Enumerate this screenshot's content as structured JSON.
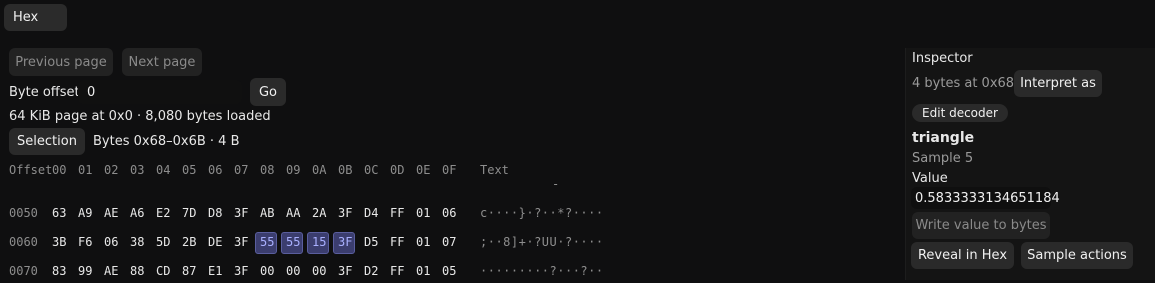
{
  "view_select": {
    "value": "Hex"
  },
  "nav": {
    "previous_page": "Previous page",
    "next_page": "Next page"
  },
  "offset": {
    "label": "Byte offset",
    "value": "0",
    "go": "Go"
  },
  "page_info": "64 KiB page at 0x0 · 8,080 bytes loaded",
  "selection": {
    "button": "Selection",
    "range": "Bytes 0x68–0x6B · 4 B"
  },
  "hex": {
    "header_offset": "Offset",
    "columns": [
      "00",
      "01",
      "02",
      "03",
      "04",
      "05",
      "06",
      "07",
      "08",
      "09",
      "0A",
      "0B",
      "0C",
      "0D",
      "0E",
      "0F"
    ],
    "header_text": "Text",
    "header_extra": "-",
    "rows": [
      {
        "offset": "0050",
        "bytes": [
          "63",
          "A9",
          "AE",
          "A6",
          "E2",
          "7D",
          "D8",
          "3F",
          "AB",
          "AA",
          "2A",
          "3F",
          "D4",
          "FF",
          "01",
          "06"
        ],
        "text": "c····}·?··*?····",
        "highlight": []
      },
      {
        "offset": "0060",
        "bytes": [
          "3B",
          "F6",
          "06",
          "38",
          "5D",
          "2B",
          "DE",
          "3F",
          "55",
          "55",
          "15",
          "3F",
          "D5",
          "FF",
          "01",
          "07"
        ],
        "text": ";··8]+·?UU·?····",
        "highlight": [
          8,
          9,
          10,
          11
        ]
      },
      {
        "offset": "0070",
        "bytes": [
          "83",
          "99",
          "AE",
          "88",
          "CD",
          "87",
          "E1",
          "3F",
          "00",
          "00",
          "00",
          "3F",
          "D2",
          "FF",
          "01",
          "05"
        ],
        "text": "·········?···?··",
        "highlight": []
      }
    ]
  },
  "inspector": {
    "title": "Inspector",
    "summary": "4 bytes at 0x68",
    "interpret_as": "Interpret as",
    "edit_decoder": "Edit decoder",
    "decoder_name": "triangle",
    "sample": "Sample 5",
    "value_label": "Value",
    "value": "0.5833333134651184",
    "write_button": "Write value to bytes",
    "reveal_button": "Reveal in Hex",
    "sample_actions": "Sample actions"
  },
  "colors": {
    "highlight_bg": "#3b3d6e",
    "highlight_text": "#a9b0ff",
    "background": "#0f0f10"
  }
}
